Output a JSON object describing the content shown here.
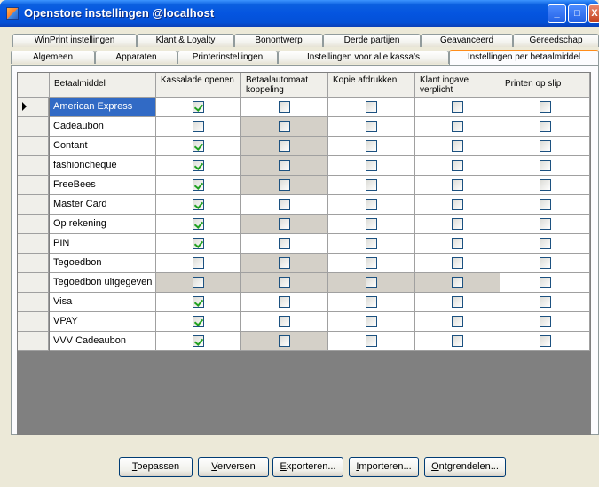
{
  "window": {
    "title": "Openstore instellingen @localhost",
    "min_label": "_",
    "max_label": "□",
    "close_label": "X"
  },
  "tabs_row1": [
    "WinPrint instellingen",
    "Klant & Loyalty",
    "Bonontwerp",
    "Derde partijen",
    "Geavanceerd",
    "Gereedschap"
  ],
  "tabs_row2": [
    "Algemeen",
    "Apparaten",
    "Printerinstellingen",
    "Instellingen voor alle kassa's",
    "Instellingen per betaalmiddel"
  ],
  "active_tab": "Instellingen per betaalmiddel",
  "grid": {
    "headers": [
      "Betaalmiddel",
      "Kassalade openen",
      "Betaalautomaat koppeling",
      "Kopie afdrukken",
      "Klant ingave verplicht",
      "Printen op slip"
    ],
    "rows": [
      {
        "name": "American Express",
        "checks": [
          true,
          false,
          false,
          false,
          false
        ],
        "gray": [
          false,
          false,
          false,
          false,
          false
        ],
        "selected": true
      },
      {
        "name": "Cadeaubon",
        "checks": [
          false,
          false,
          false,
          false,
          false
        ],
        "gray": [
          false,
          true,
          false,
          false,
          false
        ]
      },
      {
        "name": "Contant",
        "checks": [
          true,
          false,
          false,
          false,
          false
        ],
        "gray": [
          false,
          true,
          false,
          false,
          false
        ]
      },
      {
        "name": "fashioncheque",
        "checks": [
          true,
          false,
          false,
          false,
          false
        ],
        "gray": [
          false,
          true,
          false,
          false,
          false
        ]
      },
      {
        "name": "FreeBees",
        "checks": [
          true,
          false,
          false,
          false,
          false
        ],
        "gray": [
          false,
          true,
          false,
          false,
          false
        ]
      },
      {
        "name": "Master Card",
        "checks": [
          true,
          false,
          false,
          false,
          false
        ],
        "gray": [
          false,
          false,
          false,
          false,
          false
        ]
      },
      {
        "name": "Op rekening",
        "checks": [
          true,
          false,
          false,
          false,
          false
        ],
        "gray": [
          false,
          true,
          false,
          false,
          false
        ]
      },
      {
        "name": "PIN",
        "checks": [
          true,
          false,
          false,
          false,
          false
        ],
        "gray": [
          false,
          false,
          false,
          false,
          false
        ]
      },
      {
        "name": "Tegoedbon",
        "checks": [
          false,
          false,
          false,
          false,
          false
        ],
        "gray": [
          false,
          true,
          false,
          false,
          false
        ]
      },
      {
        "name": "Tegoedbon uitgegeven",
        "checks": [
          false,
          false,
          false,
          false,
          false
        ],
        "gray": [
          true,
          true,
          true,
          true,
          false
        ]
      },
      {
        "name": "Visa",
        "checks": [
          true,
          false,
          false,
          false,
          false
        ],
        "gray": [
          false,
          false,
          false,
          false,
          false
        ]
      },
      {
        "name": "VPAY",
        "checks": [
          true,
          false,
          false,
          false,
          false
        ],
        "gray": [
          false,
          false,
          false,
          false,
          false
        ]
      },
      {
        "name": "VVV Cadeaubon",
        "checks": [
          true,
          false,
          false,
          false,
          false
        ],
        "gray": [
          false,
          true,
          false,
          false,
          false
        ]
      }
    ]
  },
  "buttons": [
    {
      "mnemonic": "T",
      "rest": "oepassen"
    },
    {
      "mnemonic": "V",
      "rest": "erversen"
    },
    {
      "mnemonic": "E",
      "rest": "xporteren..."
    },
    {
      "mnemonic": "I",
      "rest": "mporteren..."
    },
    {
      "mnemonic": "O",
      "rest": "ntgrendelen..."
    }
  ],
  "colors": {
    "selection": "#316ac5",
    "check": "#21a121",
    "disabled_cell": "#d4d0c8",
    "active_tab_accent": "#ff8c1a"
  }
}
